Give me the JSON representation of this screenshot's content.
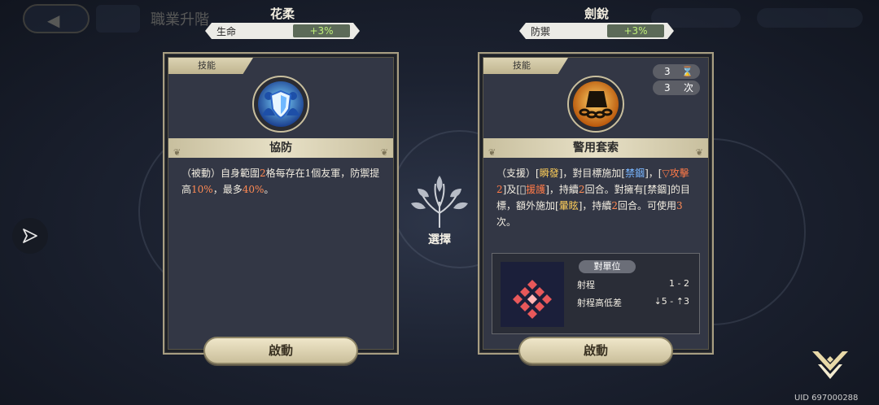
{
  "header_bg": {
    "title": "職業升階"
  },
  "left_card": {
    "header_name": "花柔",
    "stat_label": "生命",
    "stat_bonus": "+3%",
    "tab": "技能",
    "skill_name": "協防",
    "icon": "shield-allies-icon",
    "description": {
      "p1": "（被動）自身範圍",
      "n1": "2",
      "p2": "格每存在1個友軍，防禦提高",
      "n2": "10%",
      "p3": "，最多",
      "n3": "40%",
      "p4": "。"
    },
    "button_label": "啟動"
  },
  "right_card": {
    "header_name": "劍銳",
    "stat_label": "防禦",
    "stat_bonus": "+3%",
    "tab": "技能",
    "skill_name": "警用套索",
    "icon": "chain-lasso-icon",
    "cost_value": "3",
    "cost_icon": "hourglass-icon",
    "uses_value": "3",
    "uses_unit": "次",
    "description": {
      "p1": "（支援）[",
      "k1": "瞬發",
      "p2": "]，對目標施加[",
      "k2": "禁錮",
      "p3": "]，[",
      "k3": "▽攻擊2",
      "p4": "]及[",
      "k4": "⃠援護",
      "p5": "]，持續",
      "n1": "2",
      "p6": "回合。對擁有[禁錮]的目標，額外施加[",
      "k5": "暈眩",
      "p7": "]，持續",
      "n2": "2",
      "p8": "回合。可使用",
      "n3": "3",
      "p9": "次。"
    },
    "range": {
      "title": "對單位",
      "range_label": "射程",
      "range_value": "1 - 2",
      "height_label": "射程高低差",
      "height_value": "⇣5 - ⇡3"
    },
    "button_label": "啟動"
  },
  "center": {
    "label": "選擇"
  },
  "uid": "UID 697000288",
  "colors": {
    "accent_gold": "#c8bf9e",
    "bonus_green": "#bff07a",
    "highlight_orange": "#ff8a54"
  }
}
